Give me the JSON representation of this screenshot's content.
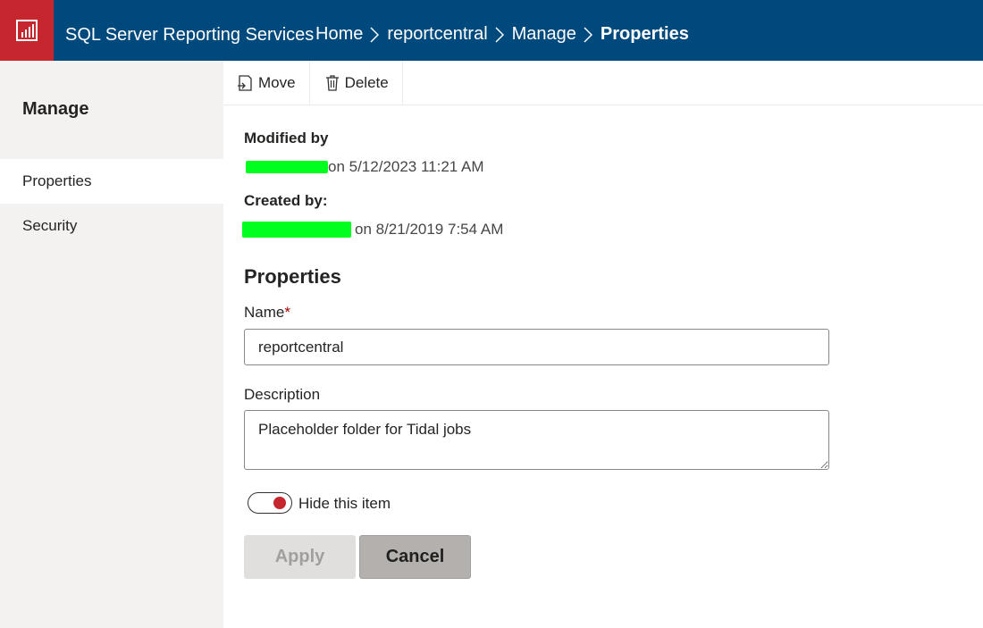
{
  "header": {
    "app_title": "SQL Server Reporting Services",
    "breadcrumbs": [
      "Home",
      "reportcentral",
      "Manage",
      "Properties"
    ],
    "colors": {
      "bar": "#00497d",
      "logo": "#c6262e"
    }
  },
  "sidebar": {
    "title": "Manage",
    "items": [
      {
        "label": "Properties",
        "active": true
      },
      {
        "label": "Security",
        "active": false
      }
    ]
  },
  "toolbar": {
    "move_label": "Move",
    "delete_label": "Delete"
  },
  "meta": {
    "modified_label": "Modified by",
    "modified_on": "on 5/12/2023 11:21 AM",
    "created_label": "Created by:",
    "created_on": "on 8/21/2019 7:54 AM"
  },
  "properties": {
    "title": "Properties",
    "name_label": "Name",
    "name_required": "*",
    "name_value": "reportcentral",
    "description_label": "Description",
    "description_value": "Placeholder folder for Tidal jobs",
    "hide_label": "Hide this item",
    "hide_checked": true
  },
  "actions": {
    "apply_label": "Apply",
    "cancel_label": "Cancel"
  }
}
